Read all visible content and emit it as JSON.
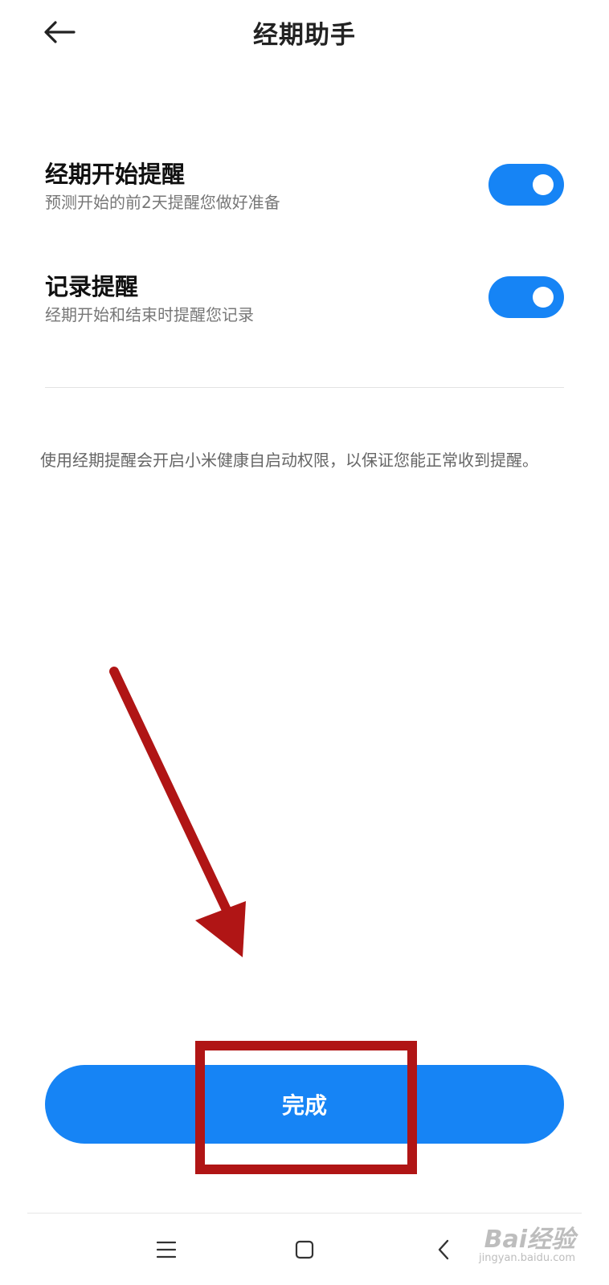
{
  "header": {
    "title": "经期助手",
    "back_icon": "arrow-left-icon"
  },
  "settings": [
    {
      "title": "经期开始提醒",
      "description": "预测开始的前2天提醒您做好准备",
      "enabled": true
    },
    {
      "title": "记录提醒",
      "description": "经期开始和结束时提醒您记录",
      "enabled": true
    }
  ],
  "note": "使用经期提醒会开启小米健康自启动权限，以保证您能正常收到提醒。",
  "done_button": {
    "label": "完成"
  },
  "nav_bar": {
    "menu_icon": "menu-icon",
    "home_icon": "home-square-icon",
    "back_icon": "chevron-left-icon"
  },
  "watermark": {
    "logo": "Bai经验",
    "url": "jingyan.baidu.com"
  },
  "colors": {
    "accent": "#1684f5",
    "annotation": "#b01515",
    "text_primary": "#111111",
    "text_secondary": "#777777"
  }
}
